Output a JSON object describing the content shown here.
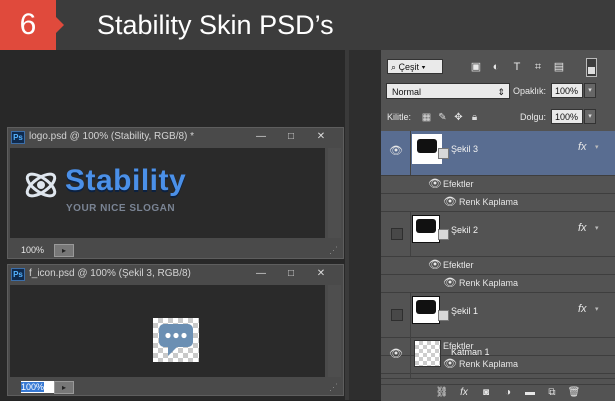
{
  "banner": {
    "step": "6",
    "title": "Stability Skin PSD’s",
    "step_color": "#e04a3c"
  },
  "windows": {
    "logo": {
      "title": "logo.psd @ 100% (Stability, RGB/8) *",
      "logo_text": "Stability",
      "slogan": "YOUR NICE SLOGAN",
      "zoom": "100%"
    },
    "f_icon": {
      "title": "f_icon.psd @ 100% (Şekil 3, RGB/8)",
      "zoom": "100%"
    },
    "controls": {
      "minimize": "—",
      "maximize": "□",
      "close": "✕"
    }
  },
  "layers_panel": {
    "filter_kind": "Çeşit",
    "blend_mode": "Normal",
    "opacity_label": "Opaklık:",
    "opacity_value": "100%",
    "lock_label": "Kilitle:",
    "fill_label": "Dolgu:",
    "fill_value": "100%",
    "selection_color": "#596d91",
    "layers": [
      {
        "name": "Şekil 3",
        "selected": true,
        "visible": true,
        "effects_label": "Efektler",
        "effect": "Renk Kaplama",
        "fx": "fx"
      },
      {
        "name": "Şekil 2",
        "selected": false,
        "visible": false,
        "effects_label": "Efektler",
        "effect": "Renk Kaplama",
        "fx": "fx"
      },
      {
        "name": "Şekil 1",
        "selected": false,
        "visible": false,
        "effects_label": "Efektler",
        "effect": "Renk Kaplama",
        "fx": "fx"
      },
      {
        "name": "Katman 1",
        "selected": false,
        "visible": true
      }
    ],
    "bottom_icons": [
      "link-icon",
      "fx-icon",
      "mask-icon",
      "adjustment-icon",
      "group-folder-icon",
      "new-layer-icon",
      "trash-icon"
    ]
  }
}
